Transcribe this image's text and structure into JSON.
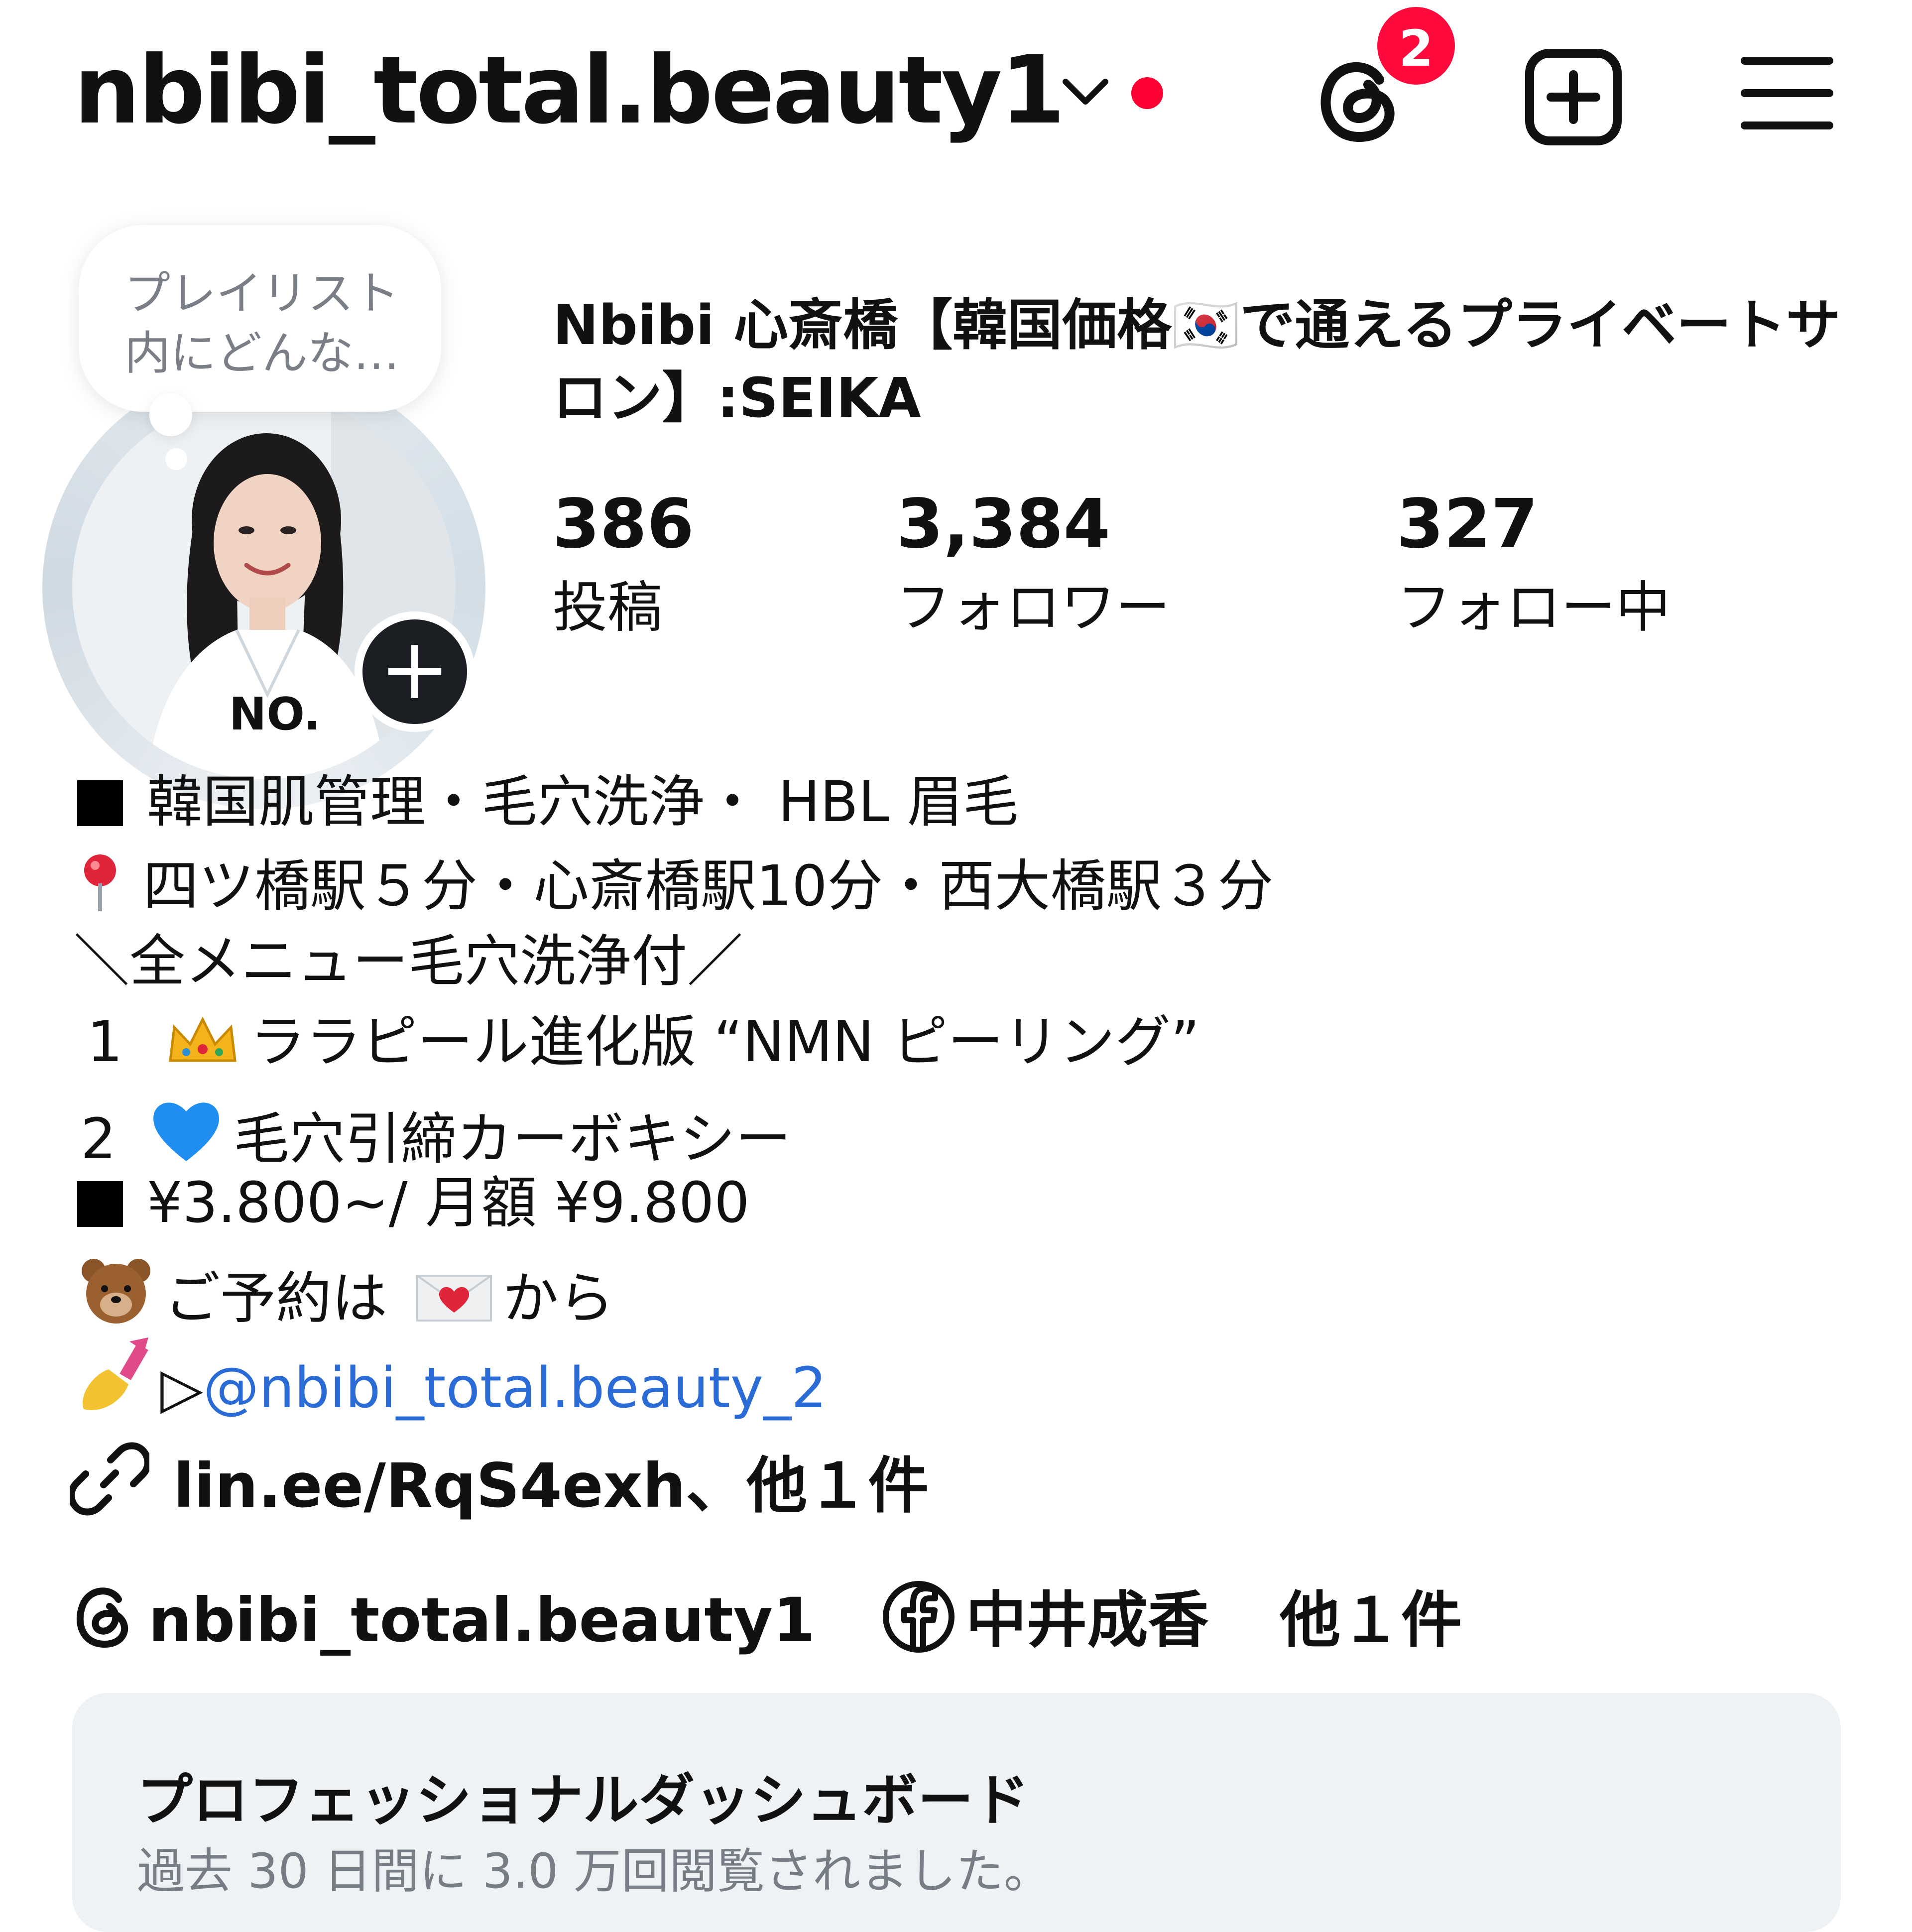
{
  "header": {
    "username": "nbibi_total.beauty1",
    "notification_count": "2",
    "icons": [
      "chevron-down-icon",
      "threads-icon",
      "create-icon",
      "hamburger-menu-icon"
    ]
  },
  "profile": {
    "note": "プレイリスト内にどんな…",
    "display_name": "Nbibi 心斎橋【韓国価格🇰🇷で通えるプライベートサロン】:SEIKA",
    "stats": [
      {
        "value": "386",
        "label": "投稿"
      },
      {
        "value": "3,384",
        "label": "フォロワー"
      },
      {
        "value": "327",
        "label": "フォロー中"
      }
    ]
  },
  "bio": {
    "line1": "韓国肌管理・毛穴洗浄・ HBL 眉毛",
    "line2": "四ツ橋駅５分・心斎橋駅10分・西大橋駅３分",
    "line3": "＼全メニュー毛穴洗浄付／",
    "line4_num": "1",
    "line4": "ララピール進化版 “NMN ピーリング”",
    "line5_num": "2",
    "line5": "毛穴引締カーボキシー",
    "line6": "¥3.800~/ 月額 ¥9.800",
    "line7a": "ご予約は",
    "line7b": "から",
    "line8_prefix": "▷",
    "line8_mention": "@nbibi_total.beauty_2"
  },
  "links": {
    "url_text": "lin.ee/RqS4exh、他１件",
    "threads_handle": "nbibi_total.beauty1",
    "facebook_name": "中井成香",
    "others": "他１件"
  },
  "dashboard": {
    "title": "プロフェッショナルダッシュボード",
    "subtitle": "過去 30 日間に 3.0 万回閲覧されました。"
  },
  "colors": {
    "accent_red": "#ff0033",
    "link_blue": "#2b6bd6",
    "dashboard_bg": "#eff2f4"
  }
}
